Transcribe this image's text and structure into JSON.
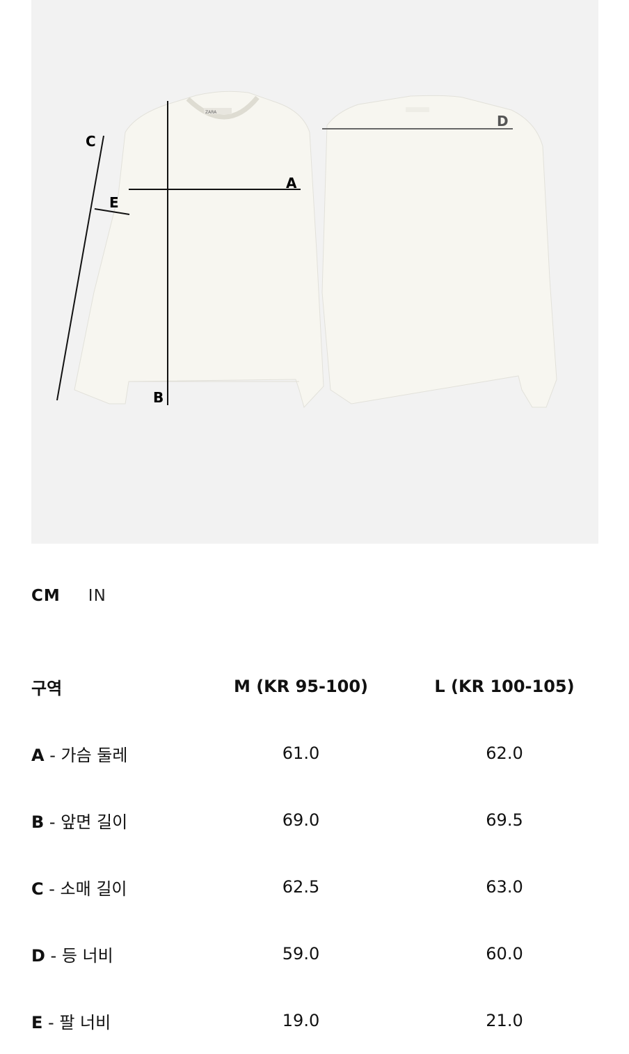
{
  "figure": {
    "labels": {
      "a": "A",
      "b": "B",
      "c": "C",
      "d": "D",
      "e": "E"
    },
    "garment_color": "#f7f6f0",
    "background_color": "#f2f2f2"
  },
  "units": {
    "cm": "CM",
    "in": "IN",
    "selected": "CM"
  },
  "table": {
    "headers": {
      "zone": "구역",
      "m": "M (KR 95-100)",
      "l": "L (KR 100-105)"
    },
    "rows": [
      {
        "letter": "A",
        "sep": " - ",
        "name": "가슴 둘레",
        "m": "61.0",
        "l": "62.0"
      },
      {
        "letter": "B",
        "sep": " - ",
        "name": "앞면 길이",
        "m": "69.0",
        "l": "69.5"
      },
      {
        "letter": "C",
        "sep": " - ",
        "name": "소매 길이",
        "m": "62.5",
        "l": "63.0"
      },
      {
        "letter": "D",
        "sep": " - ",
        "name": "등 너비",
        "m": "59.0",
        "l": "60.0"
      },
      {
        "letter": "E",
        "sep": " - ",
        "name": "팔 너비",
        "m": "19.0",
        "l": "21.0"
      }
    ]
  }
}
